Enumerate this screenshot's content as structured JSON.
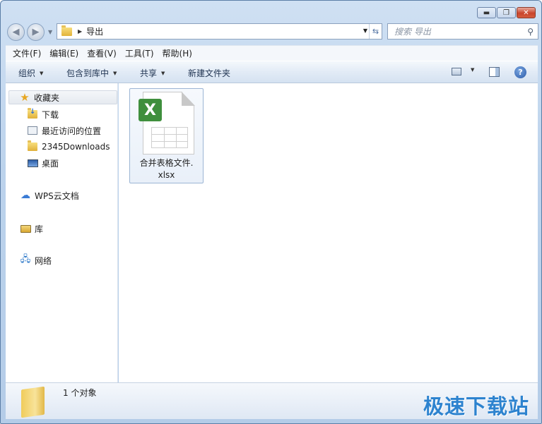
{
  "window": {
    "minimize_glyph": "▬",
    "maximize_glyph": "❐",
    "close_glyph": "✕"
  },
  "address": {
    "breadcrumb": "导出",
    "search_placeholder": "搜索 导出"
  },
  "menubar": {
    "items": [
      "文件(F)",
      "编辑(E)",
      "查看(V)",
      "工具(T)",
      "帮助(H)"
    ]
  },
  "commandbar": {
    "organize": "组织",
    "include_in_library": "包含到库中",
    "share": "共享",
    "new_folder": "新建文件夹"
  },
  "navpane": {
    "favorites": "收藏夹",
    "favorites_items": [
      "下载",
      "最近访问的位置",
      "2345Downloads",
      "桌面"
    ],
    "wps": "WPS云文档",
    "library": "库",
    "network": "网络"
  },
  "files": [
    {
      "name_line1": "合并表格文件.",
      "name_line2": "xlsx",
      "icon": "excel-icon"
    }
  ],
  "status": {
    "count": "1 个对象"
  },
  "watermark": "极速下载站",
  "colors": {
    "accent": "#2d83cf",
    "excel_green": "#3f8f3d",
    "close_red": "#c9442c"
  }
}
